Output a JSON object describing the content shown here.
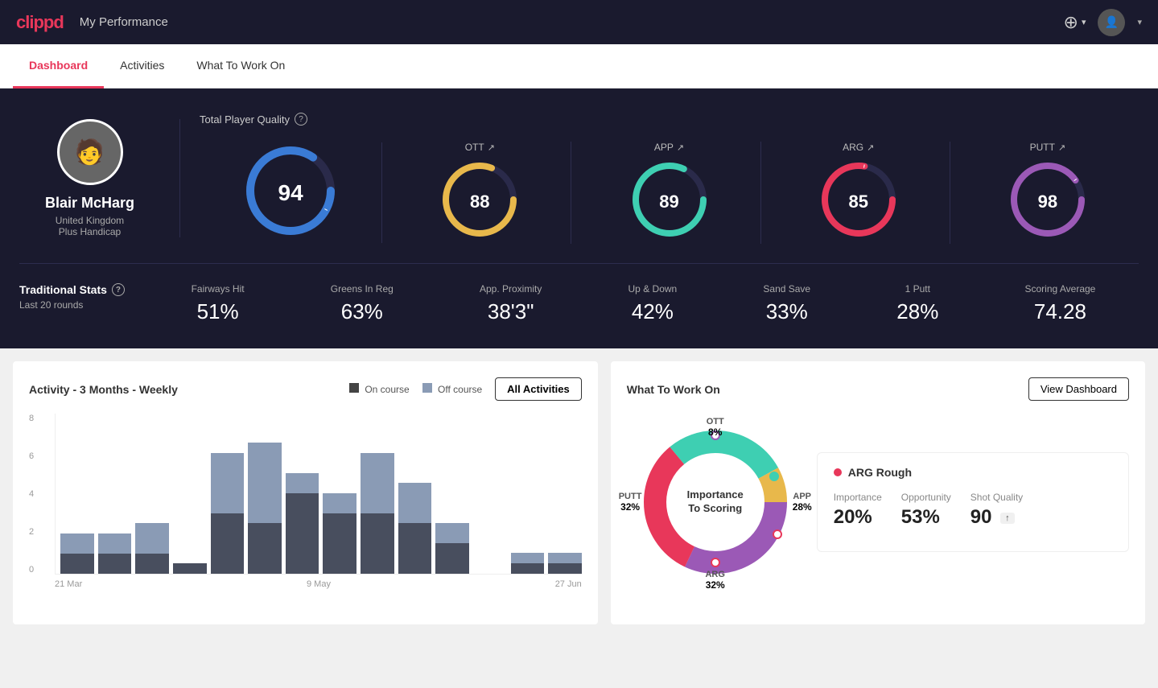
{
  "header": {
    "logo": "clippd",
    "title": "My Performance",
    "add_icon": "⊕",
    "chevron": "▾"
  },
  "nav": {
    "tabs": [
      {
        "label": "Dashboard",
        "active": true
      },
      {
        "label": "Activities",
        "active": false
      },
      {
        "label": "What To Work On",
        "active": false
      }
    ]
  },
  "player": {
    "name": "Blair McHarg",
    "country": "United Kingdom",
    "handicap": "Plus Handicap"
  },
  "quality": {
    "title": "Total Player Quality",
    "total": {
      "value": "94",
      "color_start": "#3a7bd5",
      "color_end": "#3a7bd5"
    },
    "metrics": [
      {
        "label": "OTT",
        "value": "88",
        "color": "#e8b84b"
      },
      {
        "label": "APP",
        "value": "89",
        "color": "#3ecfb2"
      },
      {
        "label": "ARG",
        "value": "85",
        "color": "#e8375a"
      },
      {
        "label": "PUTT",
        "value": "98",
        "color": "#9b59b6"
      }
    ]
  },
  "traditional_stats": {
    "title": "Traditional Stats",
    "subtitle": "Last 20 rounds",
    "items": [
      {
        "name": "Fairways Hit",
        "value": "51%"
      },
      {
        "name": "Greens In Reg",
        "value": "63%"
      },
      {
        "name": "App. Proximity",
        "value": "38'3\""
      },
      {
        "name": "Up & Down",
        "value": "42%"
      },
      {
        "name": "Sand Save",
        "value": "33%"
      },
      {
        "name": "1 Putt",
        "value": "28%"
      },
      {
        "name": "Scoring Average",
        "value": "74.28"
      }
    ]
  },
  "activity_chart": {
    "title": "Activity - 3 Months - Weekly",
    "legend_on_course": "On course",
    "legend_off_course": "Off course",
    "all_btn": "All Activities",
    "x_labels": [
      "21 Mar",
      "9 May",
      "27 Jun"
    ],
    "y_labels": [
      "0",
      "2",
      "4",
      "6",
      "8"
    ],
    "bars": [
      {
        "on": 1,
        "off": 1
      },
      {
        "on": 1,
        "off": 1
      },
      {
        "on": 1,
        "off": 1.5
      },
      {
        "on": 0.5,
        "off": 0
      },
      {
        "on": 3,
        "off": 3
      },
      {
        "on": 2.5,
        "off": 4
      },
      {
        "on": 4,
        "off": 1
      },
      {
        "on": 3,
        "off": 1
      },
      {
        "on": 3,
        "off": 3
      },
      {
        "on": 2.5,
        "off": 2
      },
      {
        "on": 1.5,
        "off": 1
      },
      {
        "on": 0,
        "off": 0
      },
      {
        "on": 0.5,
        "off": 0.5
      },
      {
        "on": 0.5,
        "off": 0.5
      }
    ]
  },
  "what_to_work_on": {
    "title": "What To Work On",
    "view_btn": "View Dashboard",
    "donut_center": "Importance\nTo Scoring",
    "segments": [
      {
        "label": "OTT",
        "percent": "8%",
        "color": "#e8b84b"
      },
      {
        "label": "APP",
        "percent": "28%",
        "color": "#3ecfb2"
      },
      {
        "label": "ARG",
        "percent": "32%",
        "color": "#e8375a"
      },
      {
        "label": "PUTT",
        "percent": "32%",
        "color": "#9b59b6"
      }
    ],
    "selected_item": {
      "title": "ARG Rough",
      "importance_label": "Importance",
      "importance_val": "20%",
      "opportunity_label": "Opportunity",
      "opportunity_val": "53%",
      "shot_quality_label": "Shot Quality",
      "shot_quality_val": "90"
    }
  }
}
